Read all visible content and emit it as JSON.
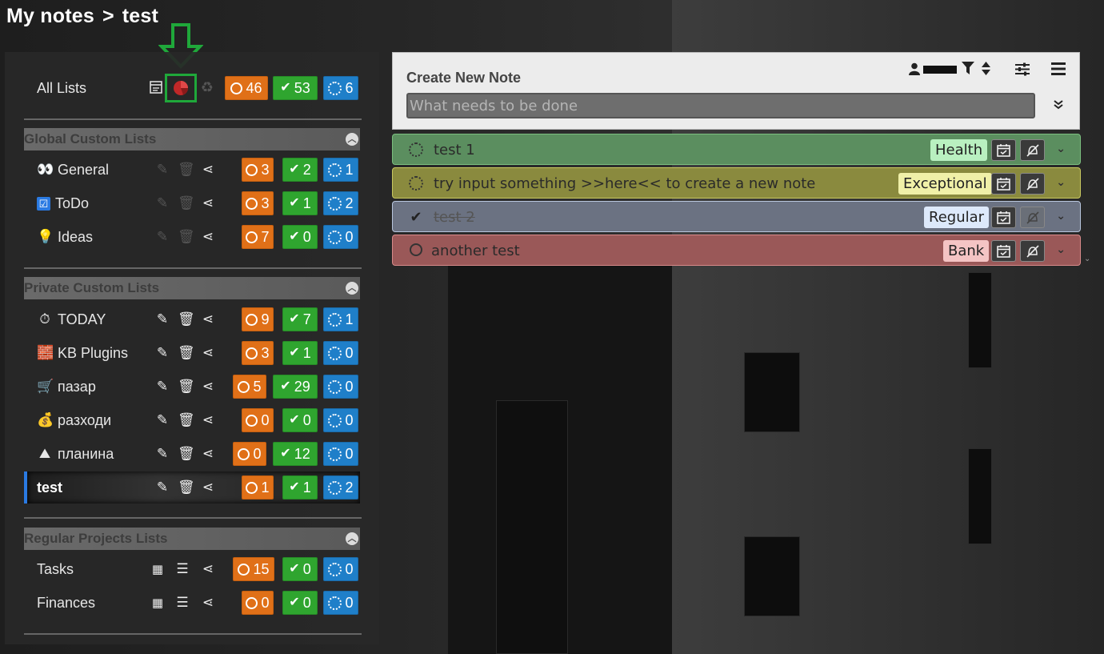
{
  "breadcrumb": {
    "root": "My notes",
    "separator": ">",
    "current": "test"
  },
  "sidebar": {
    "all_lists": {
      "label": "All Lists",
      "open": "46",
      "done": "53",
      "progress": "6"
    },
    "sections": {
      "global": {
        "title": "Global Custom Lists",
        "items": [
          {
            "label": "General",
            "icon": "👀",
            "open": "3",
            "done": "2",
            "progress": "1"
          },
          {
            "label": "ToDo",
            "icon": "☑",
            "open": "3",
            "done": "1",
            "progress": "2"
          },
          {
            "label": "Ideas",
            "icon": "💡",
            "open": "7",
            "done": "0",
            "progress": "0"
          }
        ]
      },
      "private": {
        "title": "Private Custom Lists",
        "items": [
          {
            "label": "TODAY",
            "icon": "⏱",
            "open": "9",
            "done": "7",
            "progress": "1"
          },
          {
            "label": "KB Plugins",
            "icon": "🧱",
            "open": "3",
            "done": "1",
            "progress": "0"
          },
          {
            "label": "пазар",
            "icon": "🛒",
            "open": "5",
            "done": "29",
            "progress": "0"
          },
          {
            "label": "разходи",
            "icon": "💰",
            "open": "0",
            "done": "0",
            "progress": "0"
          },
          {
            "label": "планина",
            "icon": "⛰",
            "open": "0",
            "done": "12",
            "progress": "0"
          },
          {
            "label": "test",
            "icon": "",
            "open": "1",
            "done": "1",
            "progress": "2"
          }
        ]
      },
      "projects": {
        "title": "Regular Projects Lists",
        "items": [
          {
            "label": "Tasks",
            "open": "15",
            "done": "0",
            "progress": "0"
          },
          {
            "label": "Finances",
            "open": "0",
            "done": "0",
            "progress": "0"
          }
        ]
      }
    }
  },
  "create": {
    "title": "Create New Note",
    "placeholder": "What needs to be done"
  },
  "notes": [
    {
      "text": "test 1",
      "status": "in-progress",
      "tag": "Health",
      "tag_color": "#b9f0c0"
    },
    {
      "text": "try input something >>here<< to create a new note",
      "status": "in-progress",
      "tag": "Exceptional",
      "tag_color": "#f0f0a8"
    },
    {
      "text": "test 2",
      "status": "done",
      "tag": "Regular",
      "tag_color": "#dde9fb"
    },
    {
      "text": "another test",
      "status": "open",
      "tag": "Bank",
      "tag_color": "#f4c4c4"
    }
  ],
  "colors": {
    "open": "#e07018",
    "done": "#2fa52f",
    "progress": "#1f7fc9",
    "active_marker": "#2a7ae2",
    "highlight": "#1fa83a"
  }
}
